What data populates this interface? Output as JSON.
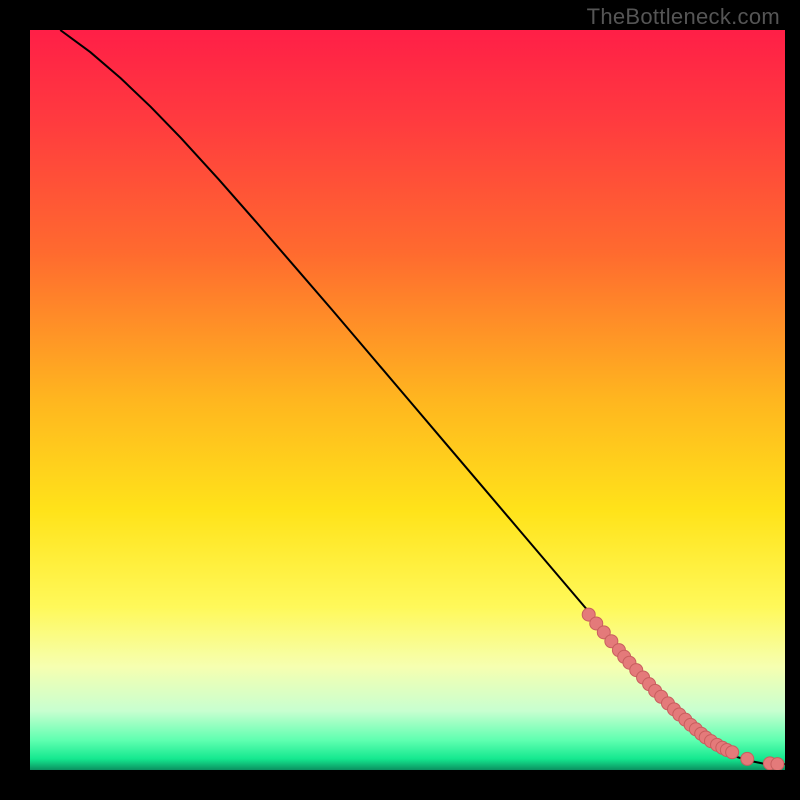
{
  "watermark": "TheBottleneck.com",
  "colors": {
    "gradient_stops": [
      {
        "offset": 0.0,
        "color": "#ff1f47"
      },
      {
        "offset": 0.12,
        "color": "#ff3a3f"
      },
      {
        "offset": 0.3,
        "color": "#ff6a2f"
      },
      {
        "offset": 0.5,
        "color": "#ffb61f"
      },
      {
        "offset": 0.65,
        "color": "#ffe31a"
      },
      {
        "offset": 0.78,
        "color": "#fff95a"
      },
      {
        "offset": 0.86,
        "color": "#f6ffb0"
      },
      {
        "offset": 0.92,
        "color": "#c8ffd0"
      },
      {
        "offset": 0.96,
        "color": "#5effb0"
      },
      {
        "offset": 0.985,
        "color": "#15e88f"
      },
      {
        "offset": 1.0,
        "color": "#0b9060"
      }
    ],
    "dot_fill": "#e47a7a",
    "dot_stroke": "#c85e5e",
    "curve": "#000000",
    "frame_bg": "#000000"
  },
  "chart_data": {
    "type": "line",
    "title": "",
    "xlabel": "",
    "ylabel": "",
    "xlim": [
      0,
      100
    ],
    "ylim": [
      0,
      100
    ],
    "series": [
      {
        "name": "curve",
        "x": [
          4,
          8,
          12,
          16,
          20,
          25,
          30,
          35,
          40,
          45,
          50,
          55,
          60,
          65,
          70,
          75,
          80,
          84,
          88,
          91,
          93.5,
          95.5,
          97,
          98.5,
          100
        ],
        "y": [
          100,
          97,
          93.5,
          89.6,
          85.4,
          79.8,
          74.0,
          68.1,
          62.2,
          56.2,
          50.2,
          44.2,
          38.2,
          32.2,
          26.2,
          20.2,
          14.2,
          9.4,
          5.4,
          3.0,
          1.8,
          1.2,
          0.9,
          0.8,
          0.8
        ]
      }
    ],
    "points": {
      "name": "scatter-cluster",
      "x": [
        74,
        75,
        76,
        77,
        78,
        78.7,
        79.4,
        80.3,
        81.2,
        82,
        82.8,
        83.6,
        84.5,
        85.3,
        86,
        86.8,
        87.5,
        88.2,
        88.9,
        89.5,
        90.2,
        91,
        91.7,
        92.3,
        93,
        95,
        98,
        99
      ],
      "y": [
        21.0,
        19.8,
        18.6,
        17.4,
        16.2,
        15.3,
        14.5,
        13.5,
        12.5,
        11.6,
        10.7,
        9.9,
        9.0,
        8.2,
        7.5,
        6.8,
        6.1,
        5.5,
        4.9,
        4.4,
        3.9,
        3.4,
        3.0,
        2.7,
        2.4,
        1.5,
        0.9,
        0.8
      ]
    }
  }
}
